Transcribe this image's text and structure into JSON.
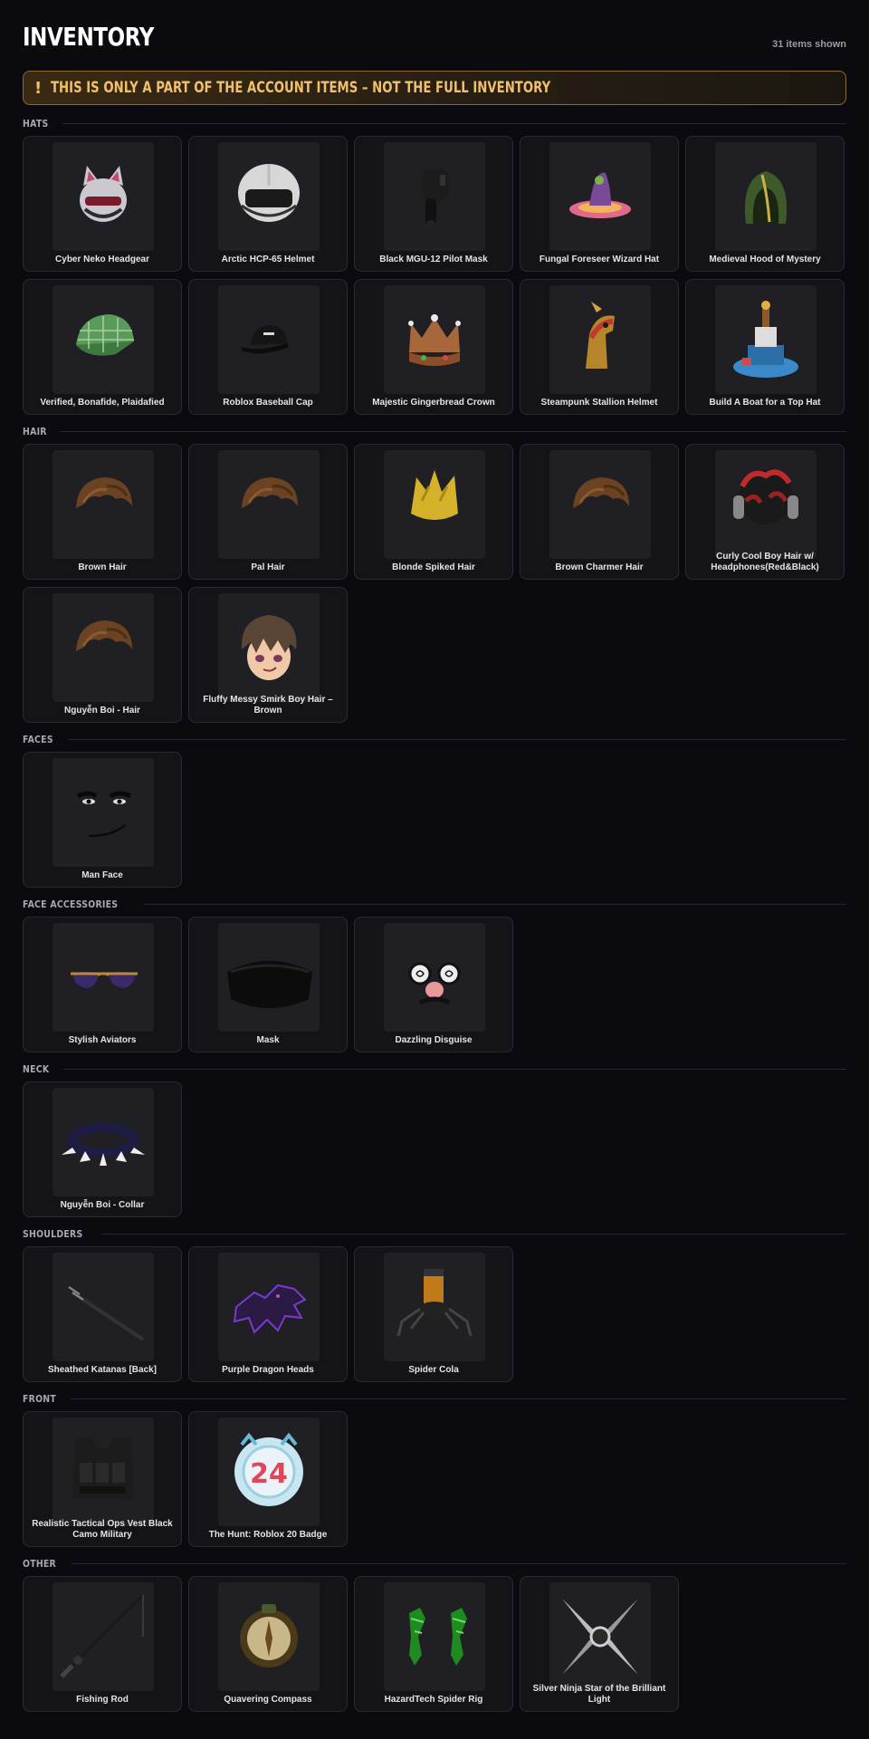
{
  "header": {
    "title": "INVENTORY",
    "count": "31 items shown"
  },
  "banner": {
    "icon": "!",
    "text": "THIS IS ONLY A PART OF THE ACCOUNT ITEMS – NOT THE FULL INVENTORY"
  },
  "sections": [
    {
      "label": "HATS",
      "items": [
        {
          "name": "Cyber Neko Headgear",
          "icon": "cat-helmet-icon"
        },
        {
          "name": "Arctic HCP-65 Helmet",
          "icon": "pilot-helmet-icon"
        },
        {
          "name": "Black MGU-12 Pilot Mask",
          "icon": "pilot-mask-icon"
        },
        {
          "name": "Fungal Foreseer Wizard Hat",
          "icon": "wizard-hat-icon"
        },
        {
          "name": "Medieval Hood of Mystery",
          "icon": "hood-icon"
        },
        {
          "name": "Verified, Bonafide, Plaidafied",
          "icon": "plaid-cap-icon"
        },
        {
          "name": "Roblox Baseball Cap",
          "icon": "baseball-cap-icon"
        },
        {
          "name": "Majestic Gingerbread Crown",
          "icon": "crown-icon"
        },
        {
          "name": "Steampunk Stallion Helmet",
          "icon": "horse-helmet-icon"
        },
        {
          "name": "Build A Boat for a Top Hat",
          "icon": "boat-hat-icon"
        }
      ]
    },
    {
      "label": "HAIR",
      "items": [
        {
          "name": "Brown Hair",
          "icon": "hair-icon"
        },
        {
          "name": "Pal Hair",
          "icon": "hair-icon"
        },
        {
          "name": "Blonde Spiked Hair",
          "icon": "spiked-hair-icon"
        },
        {
          "name": "Brown Charmer Hair",
          "icon": "hair-icon"
        },
        {
          "name": "Curly Cool Boy Hair w/ Headphones(Red&Black)",
          "icon": "curly-hair-headphones-icon"
        },
        {
          "name": "Nguyễn Boi - Hair",
          "icon": "hair-icon"
        },
        {
          "name": "Fluffy Messy Smirk Boy Hair – Brown",
          "icon": "head-with-hair-icon"
        }
      ]
    },
    {
      "label": "FACES",
      "items": [
        {
          "name": "Man Face",
          "icon": "face-icon"
        }
      ]
    },
    {
      "label": "FACE ACCESSORIES",
      "items": [
        {
          "name": "Stylish Aviators",
          "icon": "sunglasses-icon"
        },
        {
          "name": "Mask",
          "icon": "mask-icon"
        },
        {
          "name": "Dazzling Disguise",
          "icon": "disguise-glasses-icon"
        }
      ]
    },
    {
      "label": "NECK",
      "items": [
        {
          "name": "Nguyễn Boi - Collar",
          "icon": "spiked-collar-icon"
        }
      ]
    },
    {
      "label": "SHOULDERS",
      "items": [
        {
          "name": "Sheathed Katanas [Back]",
          "icon": "katana-icon"
        },
        {
          "name": "Purple Dragon Heads",
          "icon": "dragon-icon"
        },
        {
          "name": "Spider Cola",
          "icon": "spider-cola-icon"
        }
      ]
    },
    {
      "label": "FRONT",
      "items": [
        {
          "name": "Realistic Tactical Ops Vest Black Camo Military",
          "icon": "tactical-vest-icon"
        },
        {
          "name": "The Hunt: Roblox 20 Badge",
          "icon": "badge-icon"
        }
      ]
    },
    {
      "label": "OTHER",
      "items": [
        {
          "name": "Fishing Rod",
          "icon": "fishing-rod-icon"
        },
        {
          "name": "Quavering Compass",
          "icon": "compass-icon"
        },
        {
          "name": "HazardTech Spider Rig",
          "icon": "spider-rig-icon"
        },
        {
          "name": "Silver Ninja Star of the Brilliant Light",
          "icon": "ninja-star-icon"
        }
      ]
    }
  ]
}
